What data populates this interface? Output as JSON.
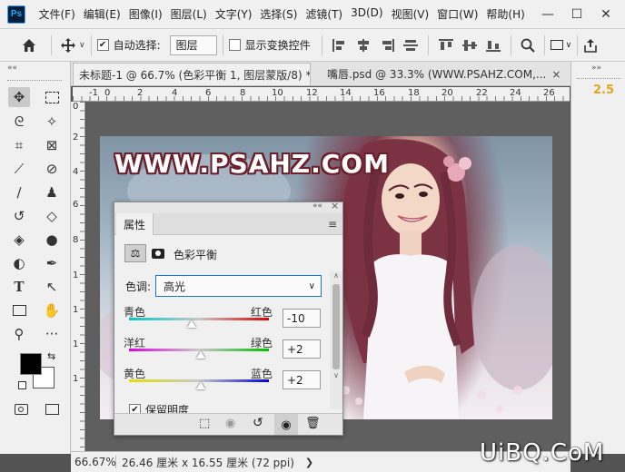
{
  "app": {
    "logo": "Ps"
  },
  "menu": [
    "文件(F)",
    "编辑(E)",
    "图像(I)",
    "图层(L)",
    "文字(Y)",
    "选择(S)",
    "滤镜(T)",
    "3D(D)",
    "视图(V)",
    "窗口(W)",
    "帮助(H)"
  ],
  "window_controls": {
    "minimize": "—",
    "maximize": "☐",
    "close": "✕"
  },
  "options": {
    "auto_select_label": "自动选择:",
    "auto_select_value": "图层",
    "show_transform_label": "显示变换控件",
    "more": "···"
  },
  "tabs": [
    {
      "label": "未标题-1 @ 66.7% (色彩平衡 1, 图层蒙版/8) *",
      "close": "×",
      "active": true
    },
    {
      "label": "嘴唇.psd @ 33.3% (WWW.PSAHZ.COM,...",
      "close": "×",
      "active": false
    }
  ],
  "ruler_top": [
    "-1",
    "0",
    "2",
    "4",
    "6",
    "8",
    "10",
    "12",
    "14",
    "16",
    "18",
    "20",
    "22",
    "24",
    "26"
  ],
  "ruler_left": [
    "0",
    "2",
    "4",
    "6",
    "8",
    "1",
    "1",
    "1",
    "1"
  ],
  "canvas": {
    "watermark_text": "WWW.PSAHZ.COM"
  },
  "right_panel": {
    "value": "2.5"
  },
  "status": {
    "zoom": "66.67%",
    "doc_info": "26.46 厘米 x 16.55 厘米 (72 ppi)",
    "arrow": "❯"
  },
  "properties": {
    "title": "属性",
    "adjustment_name": "色彩平衡",
    "tone_label": "色调:",
    "tone_value": "高光",
    "sliders": [
      {
        "left": "青色",
        "right": "红色",
        "value": "-10",
        "position": 0.45
      },
      {
        "left": "洋红",
        "right": "绿色",
        "value": "+2",
        "position": 0.51
      },
      {
        "left": "黄色",
        "right": "蓝色",
        "value": "+2",
        "position": 0.51
      }
    ],
    "preserve_label": "保留明度",
    "collapse": "««",
    "close": "×"
  },
  "site_watermark": "UiBQ.CoM",
  "colors": {
    "foreground": "#000000",
    "background": "#ffffff",
    "accent": "#1473e6",
    "zoom_label": "#e8a317"
  }
}
